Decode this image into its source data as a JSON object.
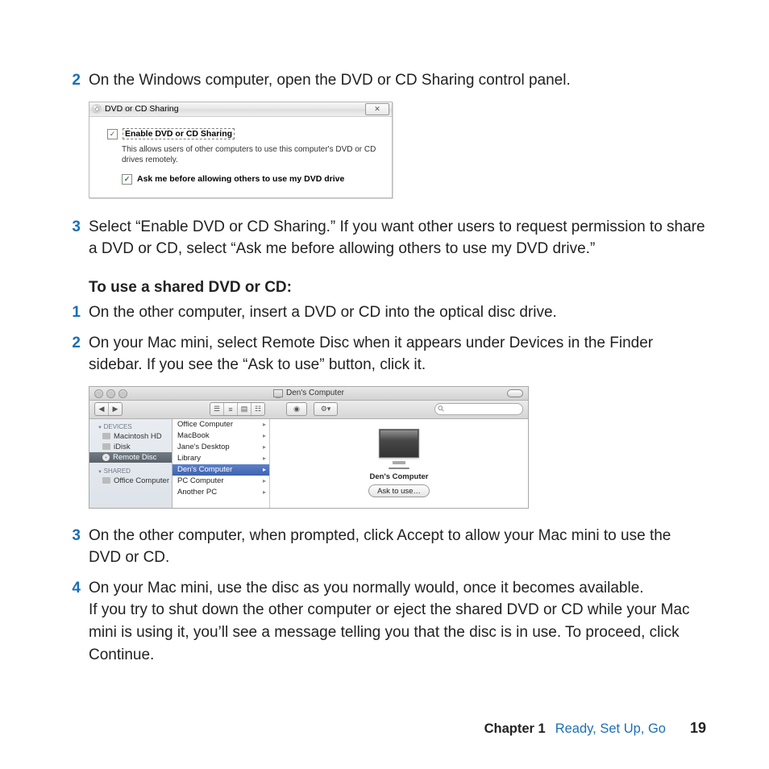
{
  "steps_a": {
    "s2": {
      "num": "2",
      "text": "On the Windows computer, open the DVD or CD Sharing control panel."
    },
    "s3": {
      "num": "3",
      "text": "Select “Enable DVD or CD Sharing.” If you want other users to request permission to share a DVD or CD, select “Ask me before allowing others to use my DVD drive.”"
    }
  },
  "sub_heading": "To use a shared DVD or CD:",
  "steps_b": {
    "s1": {
      "num": "1",
      "text": "On the other computer, insert a DVD or CD into the optical disc drive."
    },
    "s2": {
      "num": "2",
      "text": "On your Mac mini, select Remote Disc when it appears under Devices in the Finder sidebar. If you see the “Ask to use” button, click it."
    },
    "s3": {
      "num": "3",
      "text": "On the other computer, when prompted, click Accept to allow your Mac mini to use the DVD or CD."
    },
    "s4": {
      "num": "4",
      "text": "On your Mac mini, use the disc as you normally would, once it becomes available."
    },
    "s4_extra": "If you try to shut down the other computer or eject the shared DVD or CD while your Mac mini is using it, you’ll see a message telling you that the disc is in use. To proceed, click Continue."
  },
  "win_dialog": {
    "title": "DVD or CD Sharing",
    "close_glyph": "✕",
    "check_glyph": "✓",
    "enable_label": "Enable DVD or CD Sharing",
    "desc": "This allows users of other computers to use this computer's DVD or CD drives remotely.",
    "ask_label": "Ask me before allowing others to use my DVD drive"
  },
  "finder": {
    "window_title": "Den's Computer",
    "back_glyph": "◀",
    "fwd_glyph": "▶",
    "view1": "☰",
    "view2": "≡",
    "view3": "▤",
    "view4": "☷",
    "eye_glyph": "◉",
    "gear_glyph": "⚙▾",
    "search_glyph": "⚲",
    "sidebar": {
      "devices_label": "DEVICES",
      "shared_label": "SHARED",
      "macintosh_hd": "Macintosh HD",
      "idisk": "iDisk",
      "remote_disc": "Remote Disc",
      "office_computer": "Office Computer"
    },
    "list": {
      "i0": "Office Computer",
      "i1": "MacBook",
      "i2": "Jane's Desktop",
      "i3": "Library",
      "i4": "Den's Computer",
      "i5": "PC Computer",
      "i6": "Another PC"
    },
    "arrow": "▸",
    "preview_name": "Den's Computer",
    "ask_btn": "Ask to use…"
  },
  "footer": {
    "chapter": "Chapter 1",
    "title": "Ready, Set Up, Go",
    "page": "19"
  }
}
